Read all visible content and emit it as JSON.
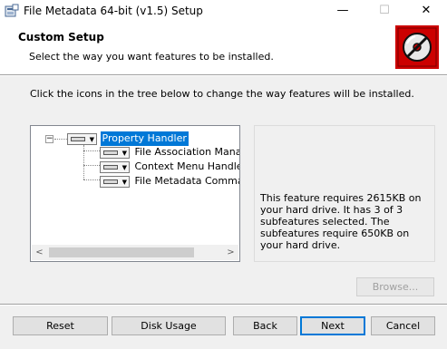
{
  "window": {
    "title": "File Metadata 64-bit (v1.5) Setup",
    "minimize": "—",
    "maximize": "☐",
    "close": "✕"
  },
  "header": {
    "title": "Custom Setup",
    "subtitle": "Select the way you want features to be installed."
  },
  "instruction": "Click the icons in the tree below to change the way features will be installed.",
  "tree": {
    "expander": "−",
    "root": {
      "label": "Property Handler",
      "selected": true
    },
    "children": [
      {
        "label": "File Association Manager"
      },
      {
        "label": "Context Menu Handler"
      },
      {
        "label": "File Metadata Command"
      }
    ],
    "scroll_left": "<",
    "scroll_right": ">"
  },
  "description": {
    "text": "This feature requires 2615KB on your hard drive. It has 3 of 3 subfeatures selected. The subfeatures require 650KB on your hard drive."
  },
  "browse_label": "Browse...",
  "footer": {
    "reset": "Reset",
    "disk_usage": "Disk Usage",
    "back": "Back",
    "next": "Next",
    "cancel": "Cancel"
  },
  "colors": {
    "accent": "#0078d7",
    "logo_red": "#cc0000"
  },
  "icons": {
    "app": "installer-icon",
    "logo": "disc-prohibited-icon",
    "feature": "hard-drive-icon"
  }
}
